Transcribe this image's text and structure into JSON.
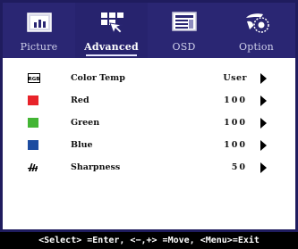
{
  "tabs": [
    {
      "label": "Picture"
    },
    {
      "label": "Advanced"
    },
    {
      "label": "OSD"
    },
    {
      "label": "Option"
    }
  ],
  "active_tab": "Advanced",
  "rows": [
    {
      "icon": "rgb-icon",
      "label": "Color Temp",
      "value": "User"
    },
    {
      "icon": "red-square-icon",
      "label": "Red",
      "value": "100",
      "color": "#e8232a"
    },
    {
      "icon": "green-square-icon",
      "label": "Green",
      "value": "100",
      "color": "#43b534"
    },
    {
      "icon": "blue-square-icon",
      "label": "Blue",
      "value": "100",
      "color": "#1d4ca0"
    },
    {
      "icon": "sharpness-icon",
      "label": "Sharpness",
      "value": "50"
    }
  ],
  "hint": "<Select> =Enter, <−,+> =Move, <Menu>=Exit",
  "colors": {
    "tab_bg": "#2a2673",
    "frame": "#1f1c5e"
  }
}
